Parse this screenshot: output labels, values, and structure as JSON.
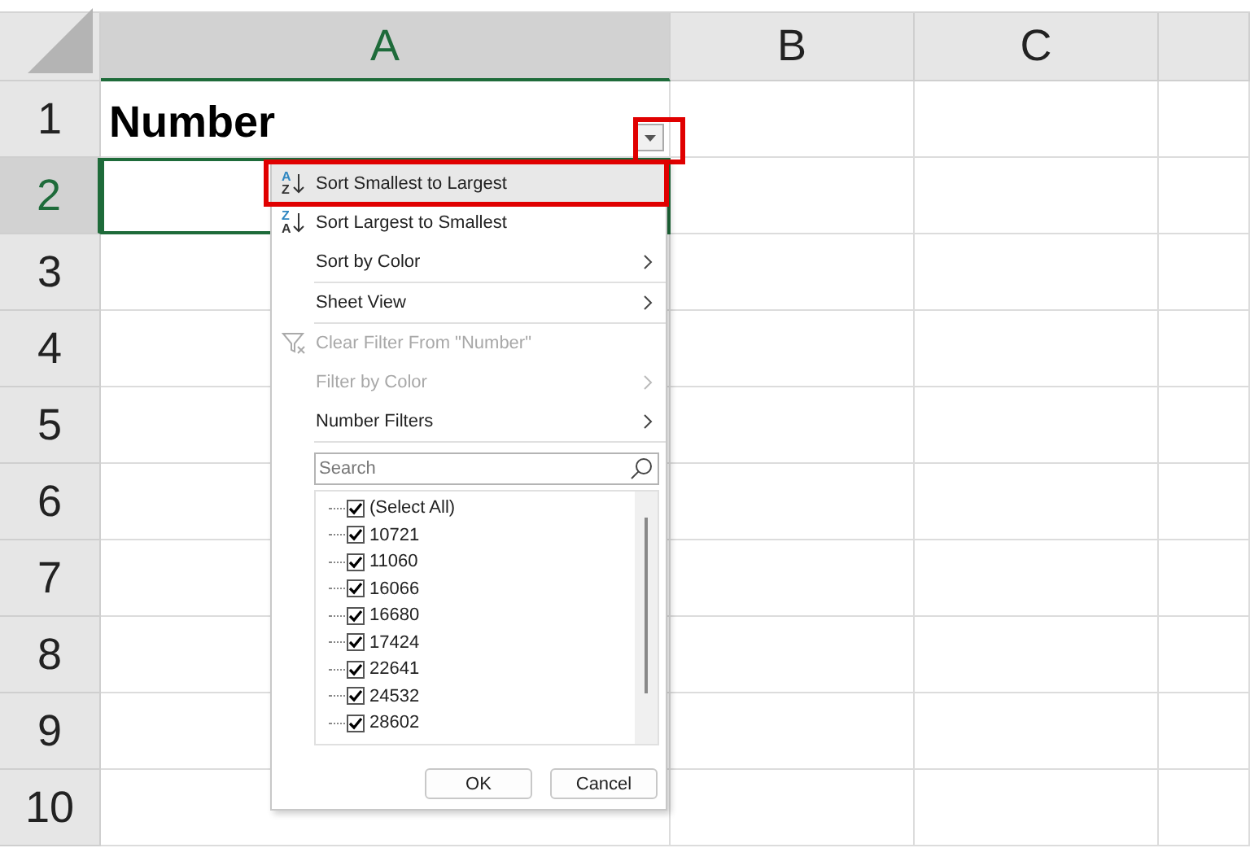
{
  "columns": [
    {
      "label": "A",
      "selected": true
    },
    {
      "label": "B",
      "selected": false
    },
    {
      "label": "C",
      "selected": false
    }
  ],
  "rows": [
    {
      "label": "1",
      "selected": false
    },
    {
      "label": "2",
      "selected": true
    },
    {
      "label": "3",
      "selected": false
    },
    {
      "label": "4",
      "selected": false
    },
    {
      "label": "5",
      "selected": false
    },
    {
      "label": "6",
      "selected": false
    },
    {
      "label": "7",
      "selected": false
    },
    {
      "label": "8",
      "selected": false
    },
    {
      "label": "9",
      "selected": false
    },
    {
      "label": "10",
      "selected": false
    }
  ],
  "header_cell": "Number",
  "filter_menu": {
    "items": [
      {
        "kind": "sort",
        "label": "Sort Smallest to Largest",
        "icon_letters": [
          "A",
          "Z"
        ],
        "selected": true,
        "disabled": false,
        "submenu": false,
        "separator_after": false
      },
      {
        "kind": "sort",
        "label": "Sort Largest to Smallest",
        "icon_letters": [
          "Z",
          "A"
        ],
        "selected": false,
        "disabled": false,
        "submenu": false,
        "separator_after": false
      },
      {
        "kind": "plain",
        "label": "Sort by Color",
        "selected": false,
        "disabled": false,
        "submenu": true,
        "separator_after": true
      },
      {
        "kind": "plain",
        "label": "Sheet View",
        "selected": false,
        "disabled": false,
        "submenu": true,
        "separator_after": true
      },
      {
        "kind": "clear",
        "label": "Clear Filter From \"Number\"",
        "selected": false,
        "disabled": true,
        "submenu": false,
        "separator_after": false
      },
      {
        "kind": "plain",
        "label": "Filter by Color",
        "selected": false,
        "disabled": true,
        "submenu": true,
        "separator_after": false
      },
      {
        "kind": "plain",
        "label": "Number Filters",
        "selected": false,
        "disabled": false,
        "submenu": true,
        "separator_after": true
      }
    ],
    "search": {
      "placeholder": "Search"
    },
    "values": [
      {
        "label": "(Select All)",
        "checked": true
      },
      {
        "label": "10721",
        "checked": true
      },
      {
        "label": "11060",
        "checked": true
      },
      {
        "label": "16066",
        "checked": true
      },
      {
        "label": "16680",
        "checked": true
      },
      {
        "label": "17424",
        "checked": true
      },
      {
        "label": "22641",
        "checked": true
      },
      {
        "label": "24532",
        "checked": true
      },
      {
        "label": "28602",
        "checked": true
      }
    ],
    "buttons": [
      "OK",
      "Cancel"
    ]
  }
}
